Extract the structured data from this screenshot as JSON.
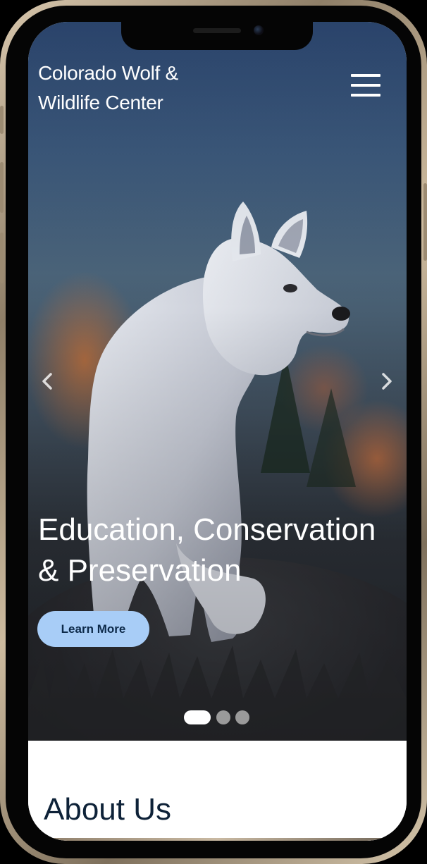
{
  "site": {
    "title": "Colorado Wolf & Wildlife Center",
    "menu_icon": "hamburger-menu-icon"
  },
  "hero": {
    "headline": "Education, Conservation & Preservation",
    "cta_label": "Learn More",
    "prev_icon": "chevron-left-icon",
    "next_icon": "chevron-right-icon",
    "image": "white-wolf-photo",
    "slides_total": 3,
    "active_slide": 1
  },
  "about": {
    "title": "About Us"
  },
  "colors": {
    "cta_background": "#a8cdf7",
    "cta_text": "#0d2a4a",
    "heading_dark": "#0e2238",
    "dot_active": "#ffffff",
    "dot_inactive": "#9a9a9a"
  }
}
